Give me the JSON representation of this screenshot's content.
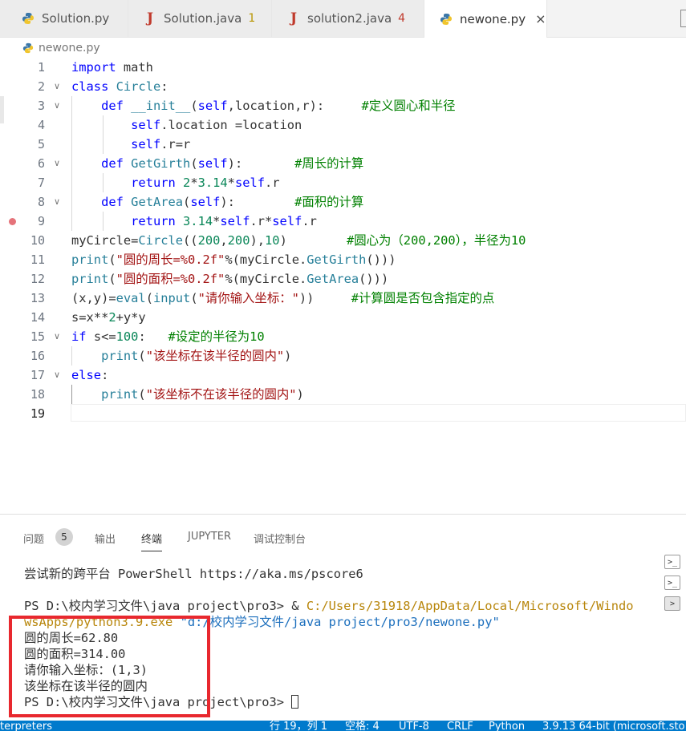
{
  "tabs": [
    {
      "label": "Solution.py",
      "icon": "python-icon",
      "badge": "",
      "active": false
    },
    {
      "label": "Solution.java",
      "icon": "java-icon",
      "badge": "1",
      "active": false
    },
    {
      "label": "solution2.java",
      "icon": "java-icon",
      "badge": "4",
      "active": false
    },
    {
      "label": "newone.py",
      "icon": "python-icon",
      "badge": "",
      "active": true,
      "close": "×"
    }
  ],
  "breadcrumb": {
    "file": "newone.py"
  },
  "line_numbers": [
    "1",
    "2",
    "3",
    "4",
    "5",
    "6",
    "7",
    "8",
    "9",
    "10",
    "11",
    "12",
    "13",
    "14",
    "15",
    "16",
    "17",
    "18",
    "19"
  ],
  "code": [
    "import math",
    "class Circle:",
    "    def __init__(self,location,r):     #定义圆心和半径",
    "        self.location =location",
    "        self.r=r",
    "    def GetGirth(self):       #周长的计算",
    "        return 2*3.14*self.r",
    "    def GetArea(self):        #面积的计算",
    "        return 3.14*self.r*self.r",
    "myCircle=Circle((200,200),10)        #圆心为（200,200），半径为10",
    "print(\"圆的周长=%0.2f\"%(myCircle.GetGirth()))",
    "print(\"圆的面积=%0.2f\"%(myCircle.GetArea()))",
    "(x,y)=eval(input(\"请你输入坐标：\"))     #计算圆是否包含指定的点",
    "s=x**2+y*y",
    "if s<=100:   #设定的半径为10",
    "    print(\"该坐标在该半径的圆内\")",
    "else:",
    "    print(\"该坐标不在该半径的圆内\")",
    ""
  ],
  "panel_tabs": [
    "问题",
    "输出",
    "终端",
    "JUPYTER",
    "调试控制台"
  ],
  "problems_count": "5",
  "terminal": {
    "line1": "尝试新的跨平台 PowerShell https://aka.ms/pscore6",
    "prompt1": "PS D:\\校内学习文件\\java project\\pro3> ",
    "cmd_amp": "& ",
    "cmd_exe_part1": "C:/Users/31918/AppData/Local/Microsoft/Windo",
    "cmd_exe_part2": "wsApps/python3.9.exe",
    "cmd_arg": "\"d:/校内学习文件/java project/pro3/newone.py\"",
    "out1": "圆的周长=62.80",
    "out2": "圆的面积=314.00",
    "out3": "请你输入坐标：(1,3)",
    "out4": "该坐标在该半径的圆内",
    "prompt2": "PS D:\\校内学习文件\\java project\\pro3> "
  },
  "status_bar": {
    "left": "terpreters",
    "position": "行 19，列 1",
    "spaces": "空格: 4",
    "encoding": "UTF-8",
    "eol": "CRLF",
    "language": "Python",
    "interpreter": "3.9.13 64-bit (microsoft.sto"
  },
  "colors": {
    "statusbar": "#007acc",
    "annotation_box": "#e8282e"
  }
}
